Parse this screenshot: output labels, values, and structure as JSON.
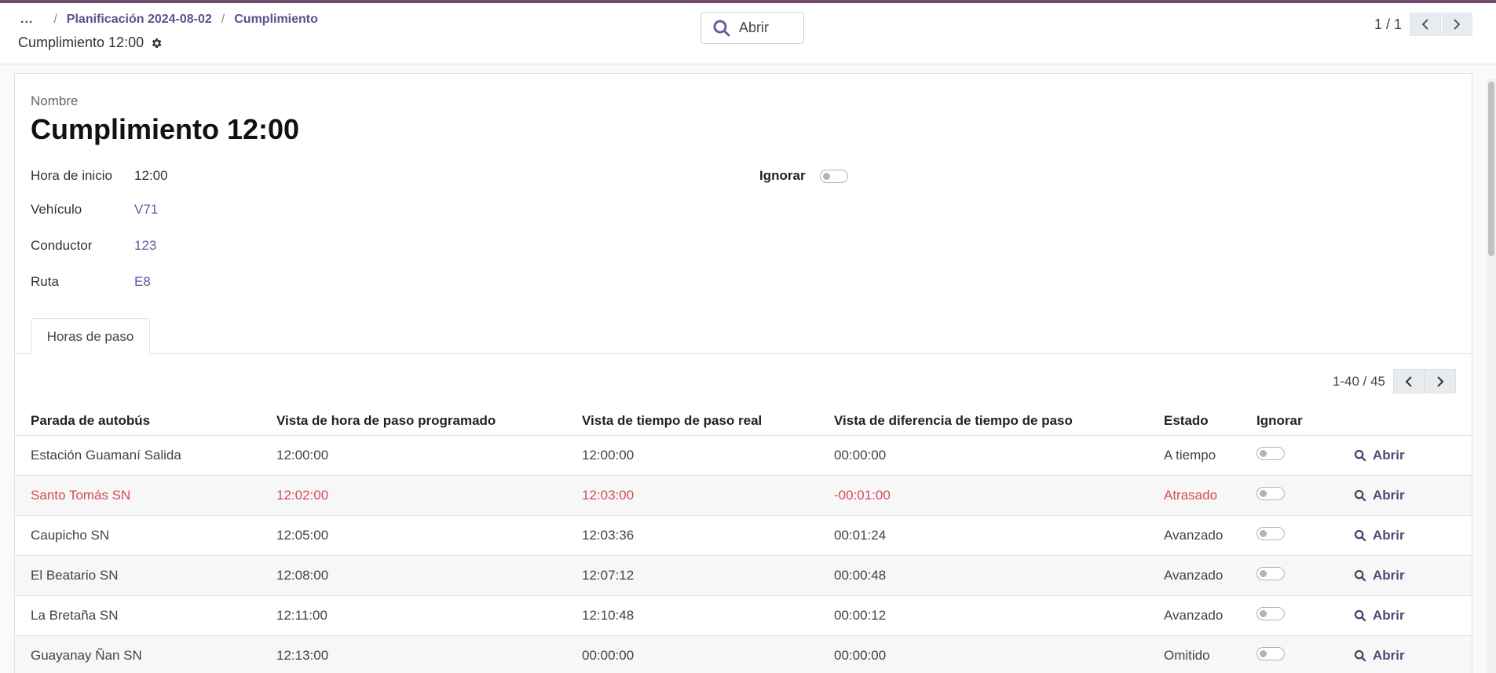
{
  "breadcrumb": {
    "dots": "...",
    "items": [
      "Planificación 2024-08-02",
      "Cumplimiento"
    ]
  },
  "record": {
    "title": "Cumplimiento 12:00"
  },
  "search": {
    "label": "Abrir"
  },
  "pager": {
    "value": "1 / 1"
  },
  "form": {
    "name_label": "Nombre",
    "name": "Cumplimiento 12:00",
    "fields": {
      "start_label": "Hora de inicio",
      "start": "12:00",
      "vehicle_label": "Vehículo",
      "vehicle": "V71",
      "driver_label": "Conductor",
      "driver": "123",
      "route_label": "Ruta",
      "route": "E8"
    },
    "ignore_label": "Ignorar"
  },
  "tabs": [
    "Horas de paso"
  ],
  "list": {
    "pager": "1-40 / 45",
    "headers": [
      "Parada de autobús",
      "Vista de hora de paso programado",
      "Vista de tiempo de paso real",
      "Vista de diferencia de tiempo de paso",
      "Estado",
      "Ignorar"
    ],
    "open_label": "Abrir",
    "rows": [
      {
        "stop": "Estación Guamaní Salida",
        "scheduled": "12:00:00",
        "actual": "12:00:00",
        "diff": "00:00:00",
        "state": "A tiempo"
      },
      {
        "stop": "Santo Tomás SN",
        "scheduled": "12:02:00",
        "actual": "12:03:00",
        "diff": "-00:01:00",
        "state": "Atrasado"
      },
      {
        "stop": "Caupicho SN",
        "scheduled": "12:05:00",
        "actual": "12:03:36",
        "diff": "00:01:24",
        "state": "Avanzado"
      },
      {
        "stop": "El Beatario SN",
        "scheduled": "12:08:00",
        "actual": "12:07:12",
        "diff": "00:00:48",
        "state": "Avanzado"
      },
      {
        "stop": "La Bretaña SN",
        "scheduled": "12:11:00",
        "actual": "12:10:48",
        "diff": "00:00:12",
        "state": "Avanzado"
      },
      {
        "stop": "Guayanay Ñan SN",
        "scheduled": "12:13:00",
        "actual": "00:00:00",
        "diff": "00:00:00",
        "state": "Omitido"
      }
    ]
  },
  "colors": {
    "accent": "#714b67",
    "link": "#5f5aa2",
    "late": "#d44c59"
  }
}
